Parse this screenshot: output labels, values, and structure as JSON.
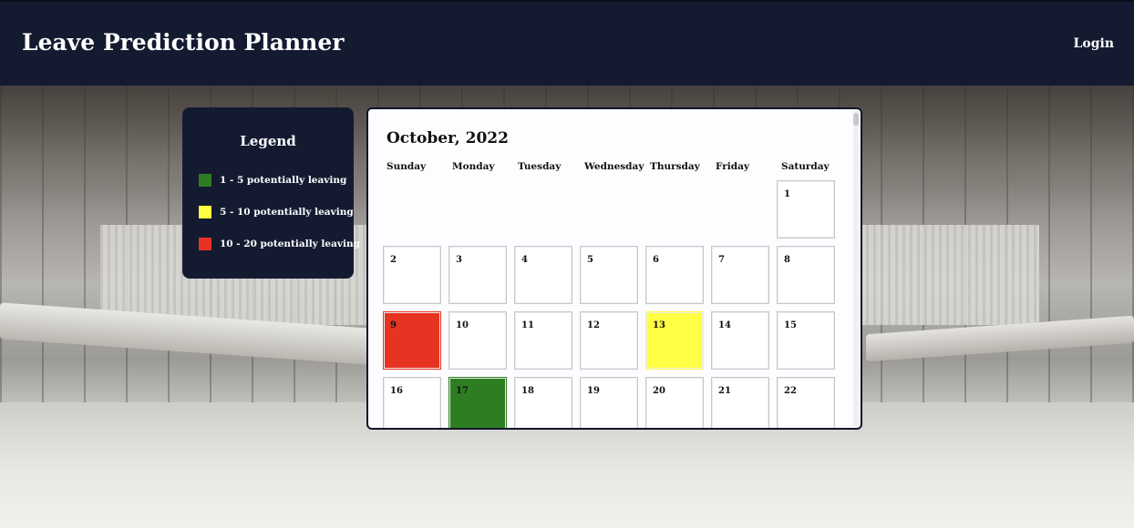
{
  "header": {
    "title": "Leave Prediction Planner",
    "login_label": "Login"
  },
  "legend": {
    "title": "Legend",
    "items": [
      {
        "label": "1 - 5 potentially leaving",
        "color": "#2e7d22"
      },
      {
        "label": "5 - 10 potentially leaving",
        "color": "#ffff44"
      },
      {
        "label": "10 - 20 potentially leaving",
        "color": "#e63322"
      }
    ]
  },
  "calendar": {
    "title": "October, 2022",
    "weekdays": [
      "Sunday",
      "Monday",
      "Tuesday",
      "Wednesday",
      "Thursday",
      "Friday",
      "Saturday"
    ],
    "days": [
      {
        "n": "1",
        "color": ""
      },
      {
        "n": "2",
        "color": ""
      },
      {
        "n": "3",
        "color": ""
      },
      {
        "n": "4",
        "color": ""
      },
      {
        "n": "5",
        "color": ""
      },
      {
        "n": "6",
        "color": ""
      },
      {
        "n": "7",
        "color": ""
      },
      {
        "n": "8",
        "color": ""
      },
      {
        "n": "9",
        "color": "#e63322"
      },
      {
        "n": "10",
        "color": ""
      },
      {
        "n": "11",
        "color": ""
      },
      {
        "n": "12",
        "color": ""
      },
      {
        "n": "13",
        "color": "#ffff44"
      },
      {
        "n": "14",
        "color": ""
      },
      {
        "n": "15",
        "color": ""
      },
      {
        "n": "16",
        "color": ""
      },
      {
        "n": "17",
        "color": "#2e7d22"
      },
      {
        "n": "18",
        "color": ""
      },
      {
        "n": "19",
        "color": ""
      },
      {
        "n": "20",
        "color": ""
      },
      {
        "n": "21",
        "color": ""
      },
      {
        "n": "22",
        "color": ""
      }
    ]
  }
}
